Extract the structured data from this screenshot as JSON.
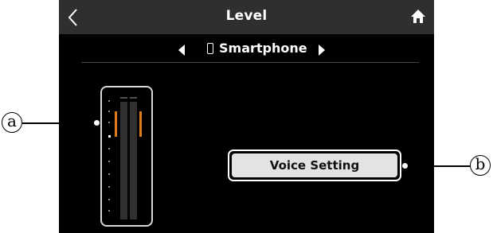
{
  "header": {
    "title": "Level",
    "back_icon": "chevron-left-icon",
    "home_icon": "home-icon"
  },
  "selector": {
    "device_name": "Smartphone",
    "device_icon": "smartphone-icon",
    "prev_icon": "triangle-left-icon",
    "next_icon": "triangle-right-icon"
  },
  "meter": {
    "channels": 2,
    "peak_color": "#e07b1e"
  },
  "voice_button": {
    "label": "Voice Setting"
  },
  "callouts": {
    "a": "a",
    "b": "b"
  }
}
